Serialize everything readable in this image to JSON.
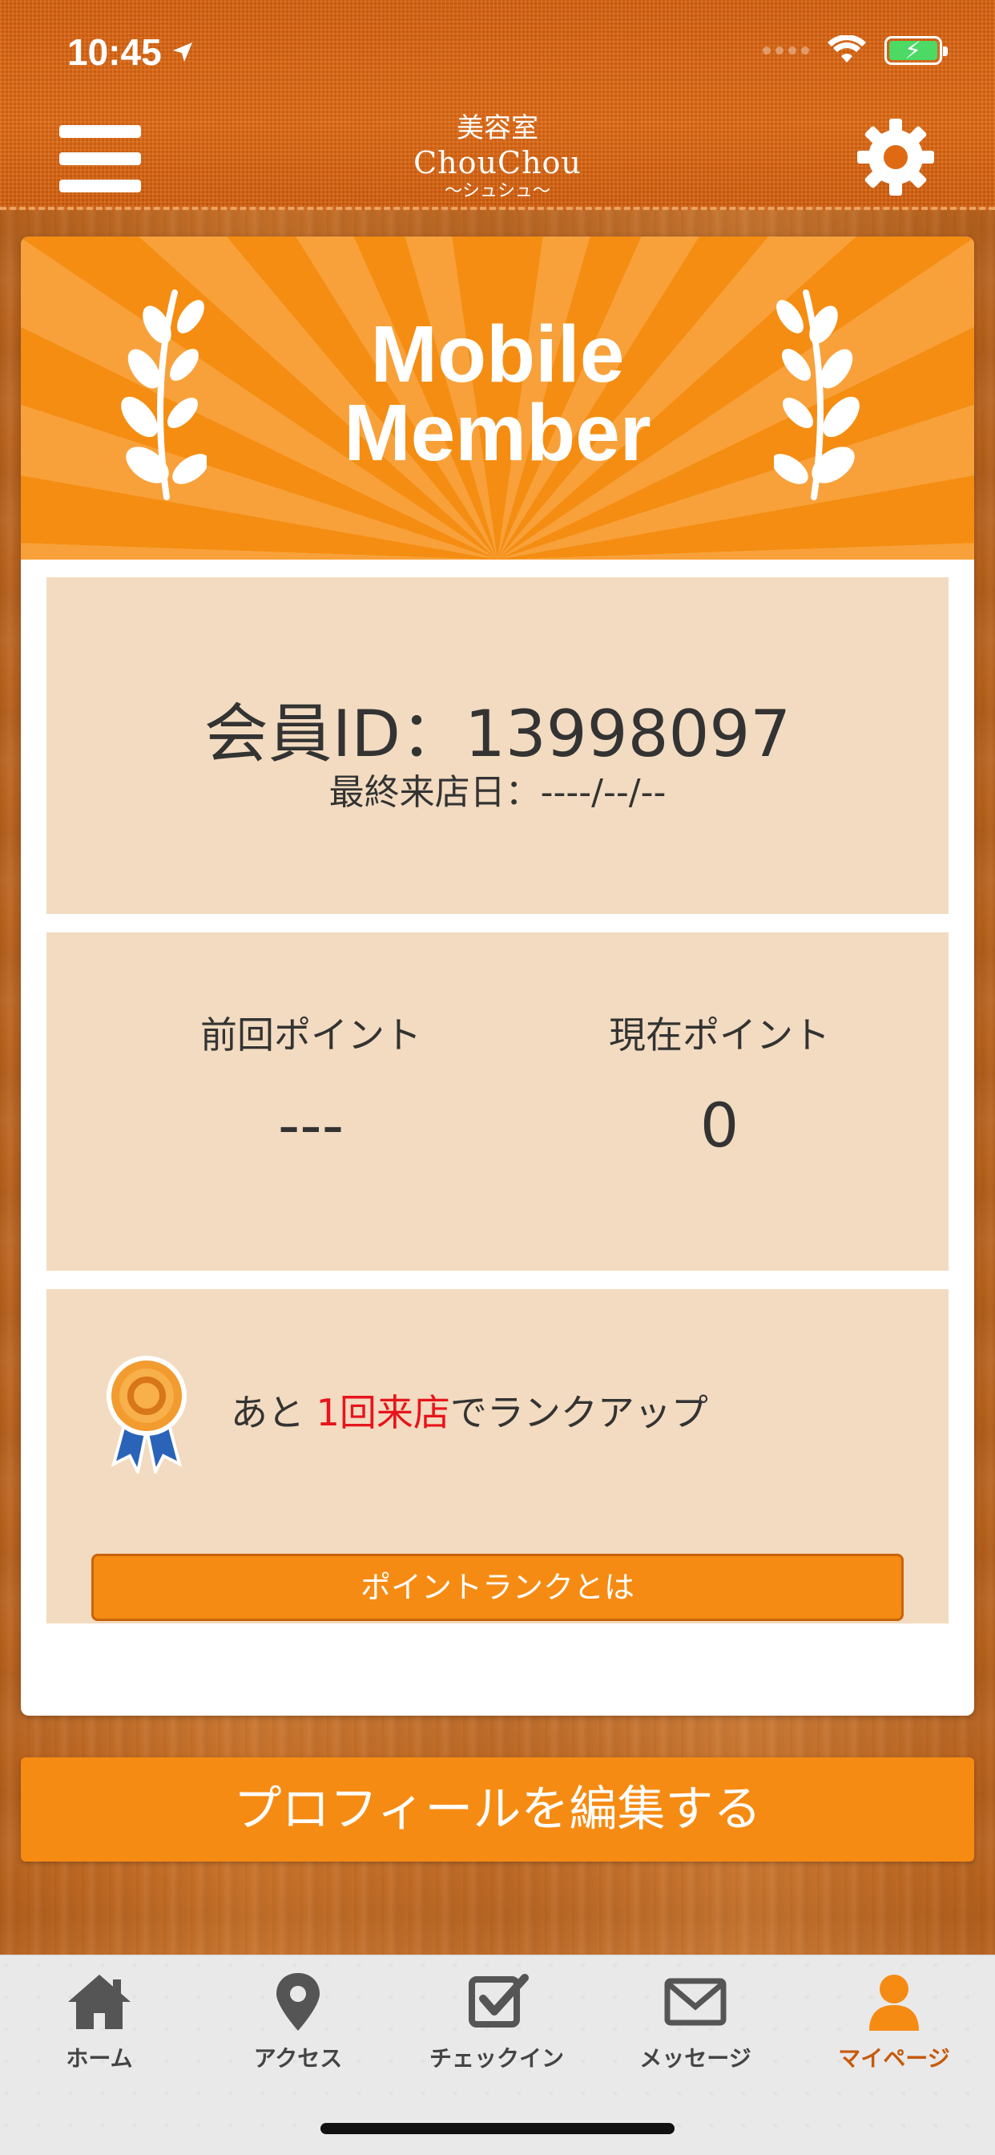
{
  "status_bar": {
    "time": "10:45"
  },
  "header": {
    "logo_line1": "美容室",
    "logo_line2": "ChouChou",
    "logo_line3": "〜シュシュ〜"
  },
  "banner": {
    "title_line1": "Mobile",
    "title_line2": "Member"
  },
  "member": {
    "id_label": "会員ID：13998097",
    "last_visit": "最終来店日：----/--/--"
  },
  "points": {
    "previous_label": "前回ポイント",
    "previous_value": "---",
    "current_label": "現在ポイント",
    "current_value": "0"
  },
  "rank": {
    "text_before": "あと ",
    "text_highlight": "1回来店",
    "text_after": "でランクアップ",
    "button_label": "ポイントランクとは"
  },
  "edit_profile_label": "プロフィールを編集する",
  "tabs": [
    {
      "label": "ホーム",
      "icon": "home-icon"
    },
    {
      "label": "アクセス",
      "icon": "map-pin-icon"
    },
    {
      "label": "チェックイン",
      "icon": "checkin-icon"
    },
    {
      "label": "メッセージ",
      "icon": "envelope-icon"
    },
    {
      "label": "マイページ",
      "icon": "user-icon",
      "active": true
    }
  ],
  "colors": {
    "accent_orange": "#f68b13",
    "panel_beige": "#f2dbc0",
    "highlight_red": "#e8141c",
    "active_tab": "#c65a0c"
  }
}
